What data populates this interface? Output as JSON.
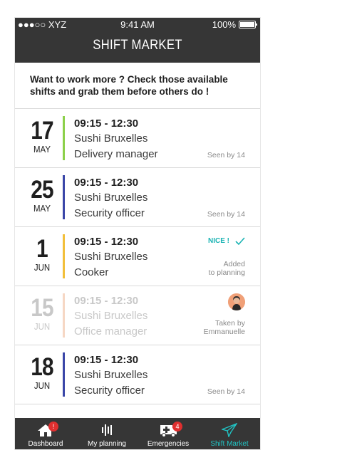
{
  "status": {
    "carrier": "●●●○○ XYZ",
    "time": "9:41 AM",
    "battery": "100%"
  },
  "header": {
    "title": "SHIFT MARKET"
  },
  "intro": "Want to work more ? Check those available shifts and grab them before others do !",
  "colors": {
    "header_bg": "#363636",
    "accent": "#1ab3b3",
    "badge": "#e02f2f"
  },
  "shifts": [
    {
      "day": "17",
      "month": "MAY",
      "time": "09:15 - 12:30",
      "place": "Sushi Bruxelles",
      "role": "Delivery manager",
      "status_text": "Seen by 14",
      "bar_color": "#8cd04a"
    },
    {
      "day": "25",
      "month": "MAY",
      "time": "09:15 - 12:30",
      "place": "Sushi Bruxelles",
      "role": "Security officer",
      "status_text": "Seen by 14",
      "bar_color": "#3a46a8"
    },
    {
      "day": "1",
      "month": "JUN",
      "time": "09:15 - 12:30",
      "place": "Sushi Bruxelles",
      "role": "Cooker",
      "nice_label": "NICE !",
      "status_line1": "Added",
      "status_line2": "to planning",
      "bar_color": "#f2bf3a"
    },
    {
      "day": "15",
      "month": "JUN",
      "time": "09:15 - 12:30",
      "place": "Sushi Bruxelles",
      "role": "Office manager",
      "status_line1": "Taken by",
      "status_line2": "Emmanuelle",
      "bar_color": "#f6d7c4"
    },
    {
      "day": "18",
      "month": "JUN",
      "time": "09:15 - 12:30",
      "place": "Sushi Bruxelles",
      "role": "Security officer",
      "status_text": "Seen by 14",
      "bar_color": "#3a46a8"
    }
  ],
  "nav": [
    {
      "label": "Dashboard",
      "icon": "home-icon",
      "badge": "!"
    },
    {
      "label": "My planning",
      "icon": "planning-icon"
    },
    {
      "label": "Emergencies",
      "icon": "ambulance-icon",
      "badge": "4"
    },
    {
      "label": "Shift Market",
      "icon": "paper-plane-icon",
      "active": true
    }
  ]
}
